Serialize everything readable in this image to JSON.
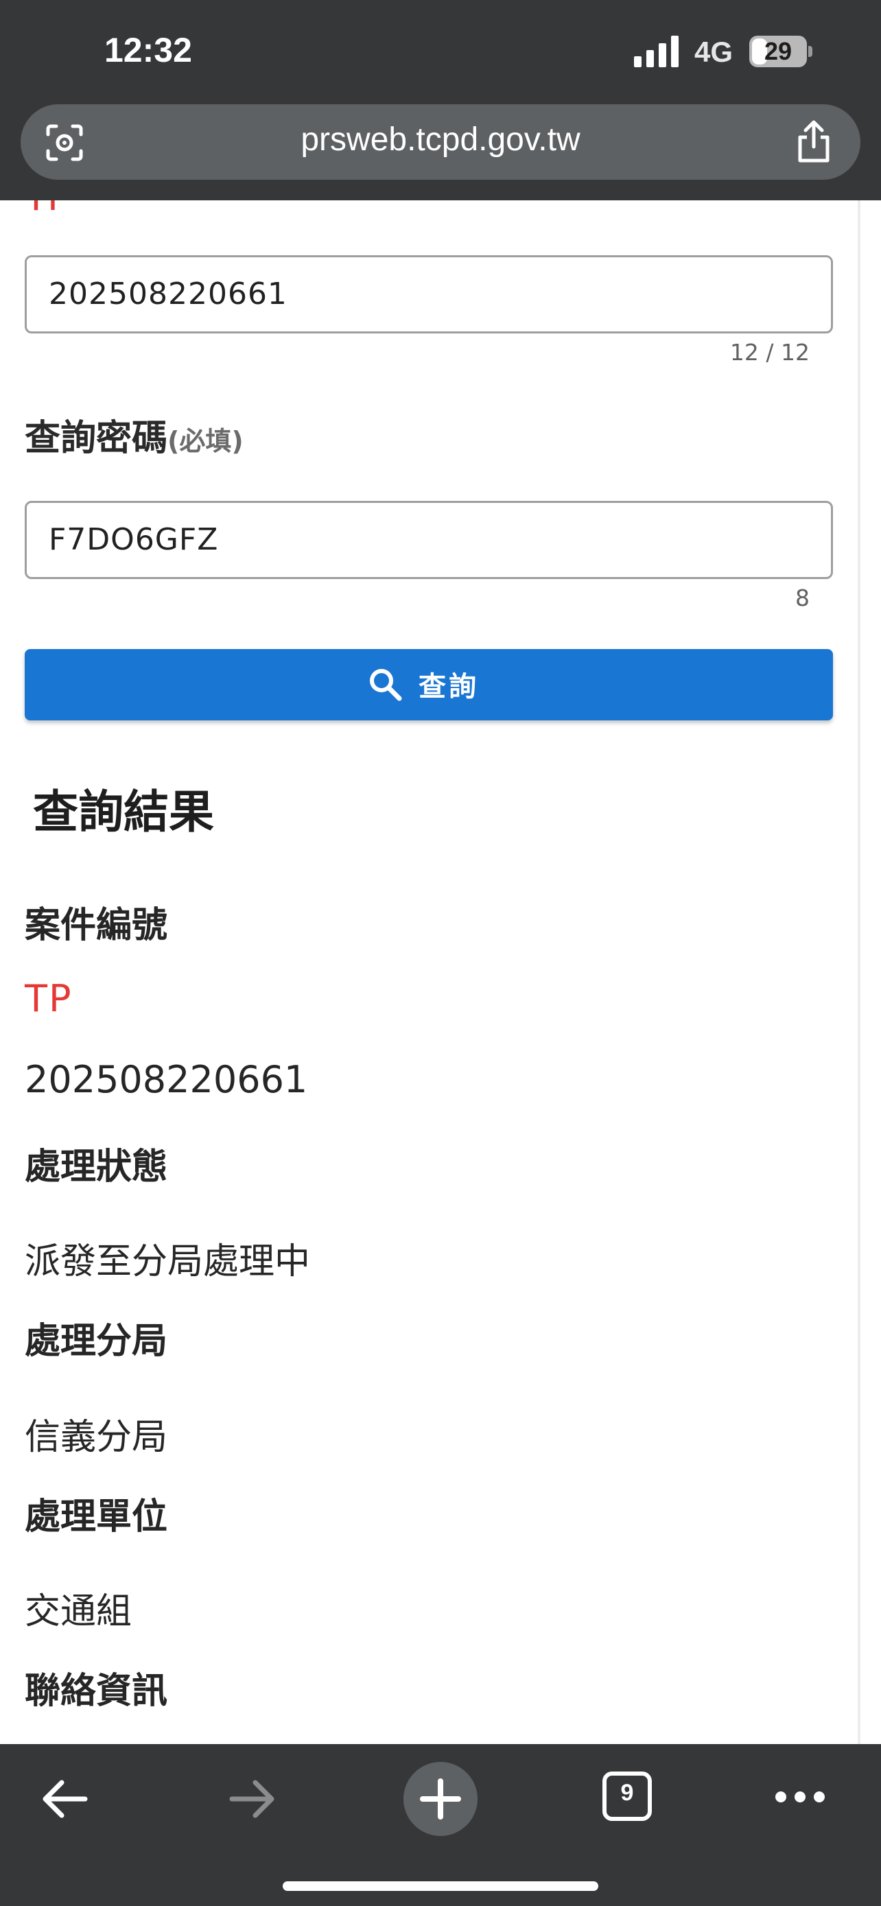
{
  "status_bar": {
    "time": "12:32",
    "network": "4G",
    "battery": "29",
    "battery_fraction": 0.29
  },
  "browser": {
    "url": "prsweb.tcpd.gov.tw",
    "lens_icon": "camera-search-icon",
    "share_icon": "share-icon"
  },
  "form": {
    "case_prefix_partial": "TP",
    "case_number": {
      "value": "202508220661",
      "counter": "12 / 12"
    },
    "password": {
      "label": "查詢密碼",
      "required": "(必填)",
      "value": "F7DO6GFZ",
      "counter": "8"
    },
    "query_button": {
      "label": "查詢",
      "icon": "search-icon"
    }
  },
  "result": {
    "title": "查詢結果",
    "case_label": "案件編號",
    "case_prefix": "TP",
    "case_number": "202508220661",
    "status_label": "處理狀態",
    "status_value": "派發至分局處理中",
    "precinct_label": "處理分局",
    "precinct_value": "信義分局",
    "unit_label": "處理單位",
    "unit_value": "交通組",
    "contact_label": "聯絡資訊"
  },
  "toolbar": {
    "back_icon": "arrow-left-icon",
    "forward_icon": "arrow-right-icon",
    "new_tab_icon": "plus-icon",
    "tab_count": "9",
    "more_icon": "more-icon"
  },
  "colors": {
    "accent": "#1976d2",
    "prefix_red": "#e53935",
    "chrome_dark": "#353739"
  }
}
